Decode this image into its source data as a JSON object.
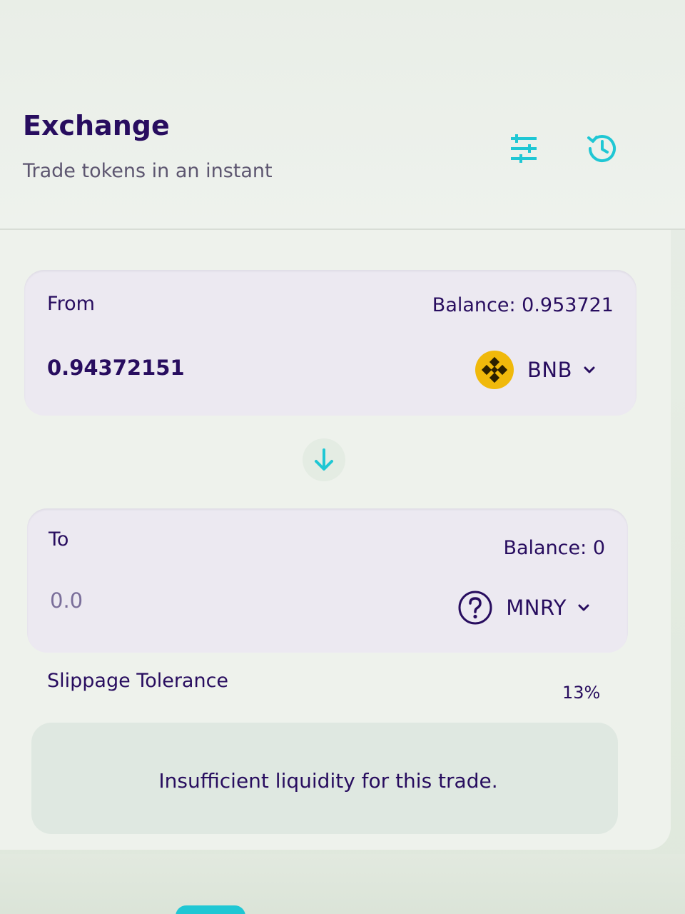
{
  "header": {
    "title": "Exchange",
    "subtitle": "Trade tokens in an instant",
    "settings_icon": "settings-sliders-icon",
    "history_icon": "history-clock-icon"
  },
  "from": {
    "label": "From",
    "balance": "Balance: 0.953721",
    "amount": "0.94372151",
    "token": "BNB",
    "token_icon": "bnb-logo-icon"
  },
  "swap_icon": "arrow-down-icon",
  "to": {
    "label": "To",
    "balance": "Balance: 0",
    "amount_placeholder": "0.0",
    "token": "MNRY",
    "token_icon": "question-circle-icon"
  },
  "slippage": {
    "label": "Slippage Tolerance",
    "value": "13%"
  },
  "error_message": "Insufficient liquidity for this trade.",
  "colors": {
    "text_primary": "#280d5f",
    "text_secondary": "#5d5670",
    "accent_teal": "#1fc7d4",
    "accent_purple": "#7b3fe4",
    "bnb_yellow": "#f0b90b",
    "panel_bg": "#ece9f1"
  }
}
